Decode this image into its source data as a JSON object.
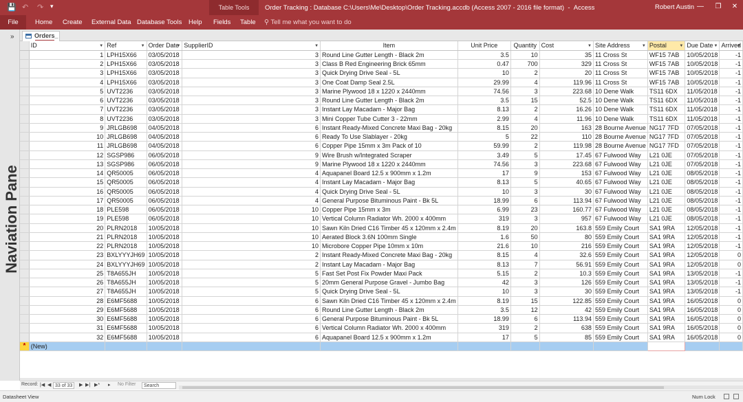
{
  "app": {
    "title": "Order Tracking : Database C:\\Users\\Me\\Desktop\\Order Tracking.accdb (Access 2007 - 2016 file format)",
    "app_name": "Access",
    "user": "Robert Austin",
    "context_label": "Table Tools"
  },
  "ribbon": {
    "tabs": [
      "File",
      "Home",
      "Create",
      "External Data",
      "Database Tools",
      "Help",
      "Fields",
      "Table"
    ],
    "tell_me": "Tell me what you want to do"
  },
  "nav_pane": {
    "label": "Naviation Pane"
  },
  "object_tab": {
    "label": "Orders_"
  },
  "grid": {
    "columns": [
      "ID",
      "Ref",
      "Order Date",
      "SupplierID",
      "Item",
      "Unit Price",
      "Quantity",
      "Cost",
      "Site Address",
      "Postal",
      "Due Date",
      "Arrived"
    ],
    "rows": [
      [
        "1",
        "LPH15X66",
        "03/05/2018",
        "3",
        "Round Line Gutter Length - Black 2m",
        "3.5",
        "10",
        "35",
        "11 Cross St",
        "WF15 7AB",
        "10/05/2018",
        "-1"
      ],
      [
        "2",
        "LPH15X66",
        "03/05/2018",
        "3",
        "Class B Red Engineering Brick 65mm",
        "0.47",
        "700",
        "329",
        "11 Cross St",
        "WF15 7AB",
        "10/05/2018",
        "-1"
      ],
      [
        "3",
        "LPH15X66",
        "03/05/2018",
        "3",
        "Quick Drying Drive Seal - 5L",
        "10",
        "2",
        "20",
        "11 Cross St",
        "WF15 7AB",
        "10/05/2018",
        "-1"
      ],
      [
        "4",
        "LPH15X66",
        "03/05/2018",
        "3",
        "One Coat Damp Seal 2.5L",
        "29.99",
        "4",
        "119.96",
        "11 Cross St",
        "WF15 7AB",
        "10/05/2018",
        "-1"
      ],
      [
        "5",
        "UVT2236",
        "03/05/2018",
        "3",
        "Marine Plywood 18 x 1220 x 2440mm",
        "74.56",
        "3",
        "223.68",
        "10 Dene Walk",
        "TS11 6DX",
        "11/05/2018",
        "-1"
      ],
      [
        "6",
        "UVT2236",
        "03/05/2018",
        "3",
        "Round Line Gutter Length - Black 2m",
        "3.5",
        "15",
        "52.5",
        "10 Dene Walk",
        "TS11 6DX",
        "11/05/2018",
        "-1"
      ],
      [
        "7",
        "UVT2236",
        "03/05/2018",
        "3",
        "Instant Lay Macadam - Major Bag",
        "8.13",
        "2",
        "16.26",
        "10 Dene Walk",
        "TS11 6DX",
        "11/05/2018",
        "-1"
      ],
      [
        "8",
        "UVT2236",
        "03/05/2018",
        "3",
        "Mini Copper Tube Cutter 3 - 22mm",
        "2.99",
        "4",
        "11.96",
        "10 Dene Walk",
        "TS11 6DX",
        "11/05/2018",
        "-1"
      ],
      [
        "9",
        "JRLGB698",
        "04/05/2018",
        "6",
        "Instant Ready-Mixed Concrete Maxi Bag - 20kg",
        "8.15",
        "20",
        "163",
        "28 Bourne Avenue",
        "NG17 7FD",
        "07/05/2018",
        "-1"
      ],
      [
        "10",
        "JRLGB698",
        "04/05/2018",
        "6",
        "Ready To Use Slablayer - 20kg",
        "5",
        "22",
        "110",
        "28 Bourne Avenue",
        "NG17 7FD",
        "07/05/2018",
        "-1"
      ],
      [
        "11",
        "JRLGB698",
        "04/05/2018",
        "6",
        "Copper Pipe 15mm x 3m Pack of 10",
        "59.99",
        "2",
        "119.98",
        "28 Bourne Avenue",
        "NG17 7FD",
        "07/05/2018",
        "-1"
      ],
      [
        "12",
        "SGSP986",
        "06/05/2018",
        "9",
        "Wire Brush w/Integrated Scraper",
        "3.49",
        "5",
        "17.45",
        "67 Fulwood Way",
        "L21 0JE",
        "07/05/2018",
        "-1"
      ],
      [
        "13",
        "SGSP986",
        "06/05/2018",
        "9",
        "Marine Plywood 18 x 1220 x 2440mm",
        "74.56",
        "3",
        "223.68",
        "67 Fulwood Way",
        "L21 0JE",
        "07/05/2018",
        "-1"
      ],
      [
        "14",
        "QR50005",
        "06/05/2018",
        "4",
        "Aquapanel Board 12.5 x 900mm x 1.2m",
        "17",
        "9",
        "153",
        "67 Fulwood Way",
        "L21 0JE",
        "08/05/2018",
        "-1"
      ],
      [
        "15",
        "QR50005",
        "06/05/2018",
        "4",
        "Instant Lay Macadam - Major Bag",
        "8.13",
        "5",
        "40.65",
        "67 Fulwood Way",
        "L21 0JE",
        "08/05/2018",
        "-1"
      ],
      [
        "16",
        "QR50005",
        "06/05/2018",
        "4",
        "Quick Drying Drive Seal - 5L",
        "10",
        "3",
        "30",
        "67 Fulwood Way",
        "L21 0JE",
        "08/05/2018",
        "-1"
      ],
      [
        "17",
        "QR50005",
        "06/05/2018",
        "4",
        "General Purpose Bituminous Paint - Bk 5L",
        "18.99",
        "6",
        "113.94",
        "67 Fulwood Way",
        "L21 0JE",
        "08/05/2018",
        "-1"
      ],
      [
        "18",
        "PLE598",
        "06/05/2018",
        "10",
        "Copper Pipe 15mm x 3m",
        "6.99",
        "23",
        "160.77",
        "67 Fulwood Way",
        "L21 0JE",
        "08/05/2018",
        "-1"
      ],
      [
        "19",
        "PLE598",
        "06/05/2018",
        "10",
        "Vertical Column Radiator Wh. 2000 x 400mm",
        "319",
        "3",
        "957",
        "67 Fulwood Way",
        "L21 0JE",
        "08/05/2018",
        "-1"
      ],
      [
        "20",
        "PLRN2018",
        "10/05/2018",
        "10",
        "Sawn Kiln Dried C16 Timber 45 x 120mm x 2.4m",
        "8.19",
        "20",
        "163.8",
        "559 Emily Court",
        "SA1 9RA",
        "12/05/2018",
        "-1"
      ],
      [
        "21",
        "PLRN2018",
        "10/05/2018",
        "10",
        "Aerated Block 3.6N 100mm Single",
        "1.6",
        "50",
        "80",
        "559 Emily Court",
        "SA1 9RA",
        "12/05/2018",
        "-1"
      ],
      [
        "22",
        "PLRN2018",
        "10/05/2018",
        "10",
        "Microbore Copper Pipe 10mm x 10m",
        "21.6",
        "10",
        "216",
        "559 Emily Court",
        "SA1 9RA",
        "12/05/2018",
        "-1"
      ],
      [
        "23",
        "BXLYYYJH69",
        "10/05/2018",
        "2",
        "Instant Ready-Mixed Concrete Maxi Bag - 20kg",
        "8.15",
        "4",
        "32.6",
        "559 Emily Court",
        "SA1 9RA",
        "12/05/2018",
        "0"
      ],
      [
        "24",
        "BXLYYYJH69",
        "10/05/2018",
        "2",
        "Instant Lay Macadam - Major Bag",
        "8.13",
        "7",
        "56.91",
        "559 Emily Court",
        "SA1 9RA",
        "12/05/2018",
        "0"
      ],
      [
        "25",
        "T8A655JH",
        "10/05/2018",
        "5",
        "Fast Set Post Fix Powder Maxi Pack",
        "5.15",
        "2",
        "10.3",
        "559 Emily Court",
        "SA1 9RA",
        "13/05/2018",
        "-1"
      ],
      [
        "26",
        "T8A655JH",
        "10/05/2018",
        "5",
        "20mm General Purpose Gravel - Jumbo Bag",
        "42",
        "3",
        "126",
        "559 Emily Court",
        "SA1 9RA",
        "13/05/2018",
        "-1"
      ],
      [
        "27",
        "T8A655JH",
        "10/05/2018",
        "5",
        "Quick Drying Drive Seal - 5L",
        "10",
        "3",
        "30",
        "559 Emily Court",
        "SA1 9RA",
        "13/05/2018",
        "-1"
      ],
      [
        "28",
        "E6MF5688",
        "10/05/2018",
        "6",
        "Sawn Kiln Dried C16 Timber 45 x 120mm x 2.4m",
        "8.19",
        "15",
        "122.85",
        "559 Emily Court",
        "SA1 9RA",
        "16/05/2018",
        "0"
      ],
      [
        "29",
        "E6MF5688",
        "10/05/2018",
        "6",
        "Round Line Gutter Length - Black 2m",
        "3.5",
        "12",
        "42",
        "559 Emily Court",
        "SA1 9RA",
        "16/05/2018",
        "0"
      ],
      [
        "30",
        "E6MF5688",
        "10/05/2018",
        "6",
        "General Purpose Bituminous Paint - Bk 5L",
        "18.99",
        "6",
        "113.94",
        "559 Emily Court",
        "SA1 9RA",
        "16/05/2018",
        "0"
      ],
      [
        "31",
        "E6MF5688",
        "10/05/2018",
        "6",
        "Vertical Column Radiator Wh. 2000 x 400mm",
        "319",
        "2",
        "638",
        "559 Emily Court",
        "SA1 9RA",
        "16/05/2018",
        "0"
      ],
      [
        "32",
        "E6MF5688",
        "10/05/2018",
        "6",
        "Aquapanel Board 12.5 x 900mm x 1.2m",
        "17",
        "5",
        "85",
        "559 Emily Court",
        "SA1 9RA",
        "16/05/2018",
        "0"
      ]
    ],
    "new_row_marker": "*",
    "new_row_label": "(New)"
  },
  "record_nav": {
    "label": "Record:",
    "current": "33 of 33",
    "filter": "No Filter",
    "search": "Search"
  },
  "status": {
    "left": "Datasheet View",
    "numlock": "Num Lock"
  },
  "colors": {
    "accent": "#a4373a",
    "selection": "#a6cdf1",
    "sorted_header": "#ffe9a8"
  }
}
